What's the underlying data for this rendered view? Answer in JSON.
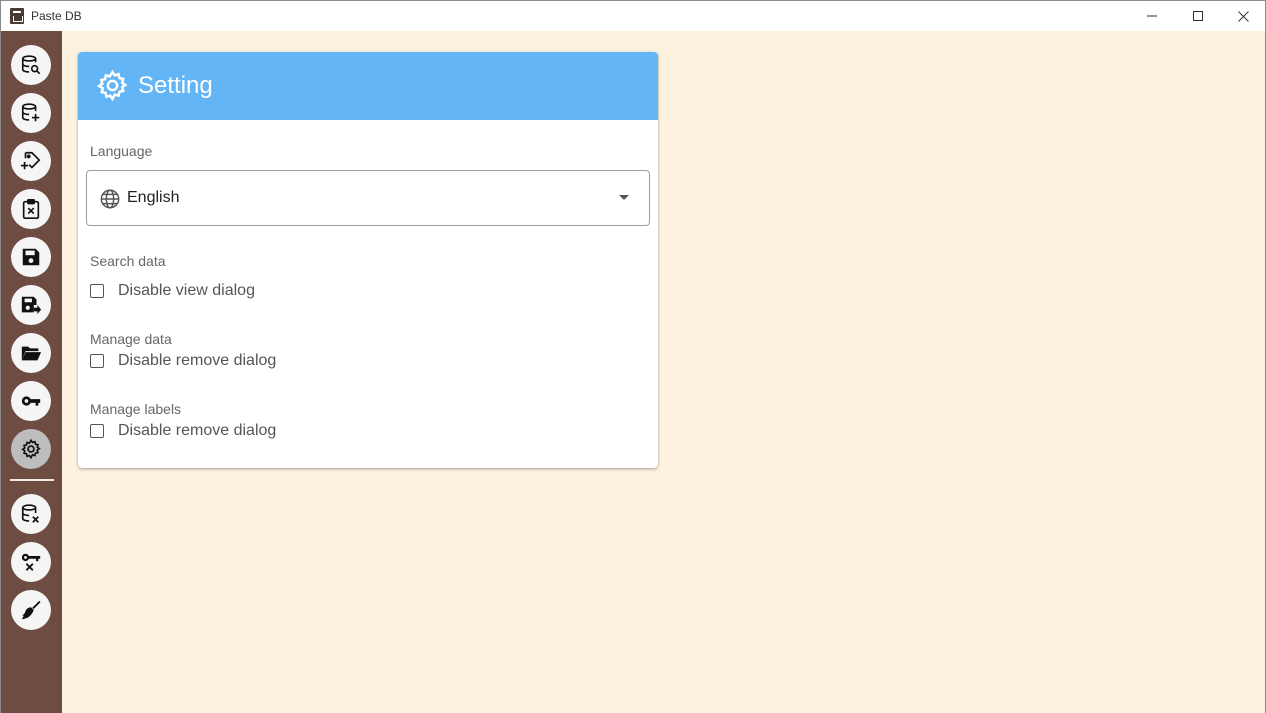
{
  "window": {
    "title": "Paste DB"
  },
  "sidebar": {
    "items": [
      {
        "name": "search-data",
        "icon": "database-search-icon"
      },
      {
        "name": "add-data",
        "icon": "database-plus-icon"
      },
      {
        "name": "add-label",
        "icon": "tag-plus-icon"
      },
      {
        "name": "clipboard-remove",
        "icon": "clipboard-x-icon"
      },
      {
        "name": "save",
        "icon": "save-icon"
      },
      {
        "name": "save-as",
        "icon": "save-move-icon"
      },
      {
        "name": "open-folder",
        "icon": "folder-open-icon"
      },
      {
        "name": "key",
        "icon": "key-icon"
      },
      {
        "name": "settings",
        "icon": "gear-icon",
        "active": true
      },
      {
        "name": "remove-database",
        "icon": "database-remove-icon"
      },
      {
        "name": "remove-key",
        "icon": "key-remove-icon"
      },
      {
        "name": "clean",
        "icon": "broom-icon"
      }
    ]
  },
  "settings": {
    "title": "Setting",
    "language": {
      "label": "Language",
      "value": "English"
    },
    "search_data": {
      "label": "Search data",
      "option": "Disable view dialog"
    },
    "manage_data": {
      "label": "Manage data",
      "option": "Disable remove dialog"
    },
    "manage_labels": {
      "label": "Manage labels",
      "option": "Disable remove dialog"
    }
  },
  "colors": {
    "sidebar": "#6e4c42",
    "header": "#64b5f6",
    "background": "#fdf1e0"
  }
}
